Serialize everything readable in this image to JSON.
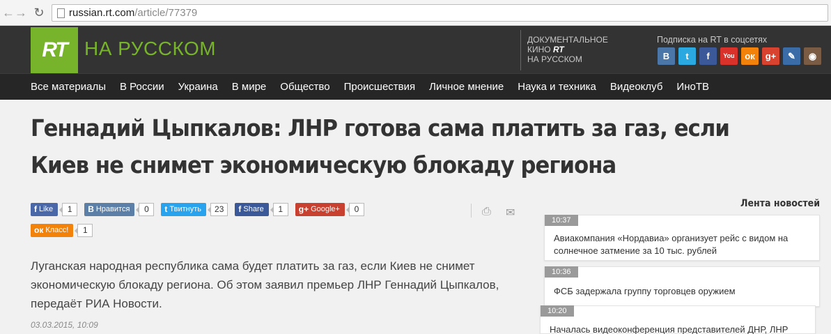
{
  "browser": {
    "url_host": "russian.rt.com",
    "url_path": "/article/77379"
  },
  "header": {
    "logo": "RT",
    "site_name": "НА РУССКОМ",
    "docs_line1": "ДОКУМЕНТАЛЬНОЕ",
    "docs_line2": "КИНО",
    "docs_brand": "RT",
    "docs_line3": "НА РУССКОМ",
    "subscribe": "Подписка на RT в соцсетях",
    "social": [
      {
        "label": "B",
        "icon": "vkontakte-icon",
        "color": "#4a76a8"
      },
      {
        "label": "t",
        "icon": "twitter-icon",
        "color": "#2aa9e0"
      },
      {
        "label": "f",
        "icon": "facebook-icon",
        "color": "#3b5998"
      },
      {
        "label": "You",
        "icon": "youtube-icon",
        "color": "#d8322b"
      },
      {
        "label": "ок",
        "icon": "odnoklassniki-icon",
        "color": "#f2820a"
      },
      {
        "label": "g+",
        "icon": "google-plus-icon",
        "color": "#d8432f"
      },
      {
        "label": "✎",
        "icon": "livejournal-icon",
        "color": "#3a6da8"
      },
      {
        "label": "◉",
        "icon": "instagram-icon",
        "color": "#7a5c45"
      }
    ]
  },
  "nav": [
    "Все материалы",
    "В России",
    "Украина",
    "В мире",
    "Общество",
    "Происшествия",
    "Личное мнение",
    "Наука и техника",
    "Видеоклуб",
    "ИноТВ"
  ],
  "article": {
    "title": "Геннадий Цыпкалов: ЛНР готова сама платить за газ, если Киев не снимет экономическую блокаду региона",
    "lead": "Луганская народная республика сама будет платить за газ, если Киев не снимет экономическую блокаду региона. Об этом заявил премьер ЛНР Геннадий Цыпкалов, передаёт РИА Новости.",
    "date": "03.03.2015, 10:09"
  },
  "share": {
    "row1": [
      {
        "label": "Like",
        "icon": "f",
        "count": "1",
        "color": "#4a67a8",
        "name": "facebook-like-button"
      },
      {
        "label": "Нравится",
        "icon": "B",
        "count": "0",
        "color": "#5b7fa6",
        "name": "vk-like-button"
      },
      {
        "label": "Твитнуть",
        "icon": "t",
        "count": "23",
        "color": "#2aa3ef",
        "name": "tweet-button"
      },
      {
        "label": "Share",
        "icon": "f",
        "count": "1",
        "color": "#3b5998",
        "name": "facebook-share-button"
      },
      {
        "label": "Google+",
        "icon": "g+",
        "count": "0",
        "color": "#c8402f",
        "name": "google-plus-button"
      }
    ],
    "row2": [
      {
        "label": "Класс!",
        "icon": "ок",
        "count": "1",
        "color": "#f2820a",
        "name": "ok-class-button"
      }
    ]
  },
  "feed": {
    "title": "Лента новостей",
    "items": [
      {
        "time": "10:37",
        "text": "Авиакомпания «Нордавиа» организует рейс с видом на солнечное затмение за 10 тыс. рублей"
      },
      {
        "time": "10:36",
        "text": "ФСБ задержала группу торговцев оружием"
      },
      {
        "time": "10:20",
        "text": "Началась видеоконференция представителей ДНР, ЛНР"
      }
    ]
  }
}
